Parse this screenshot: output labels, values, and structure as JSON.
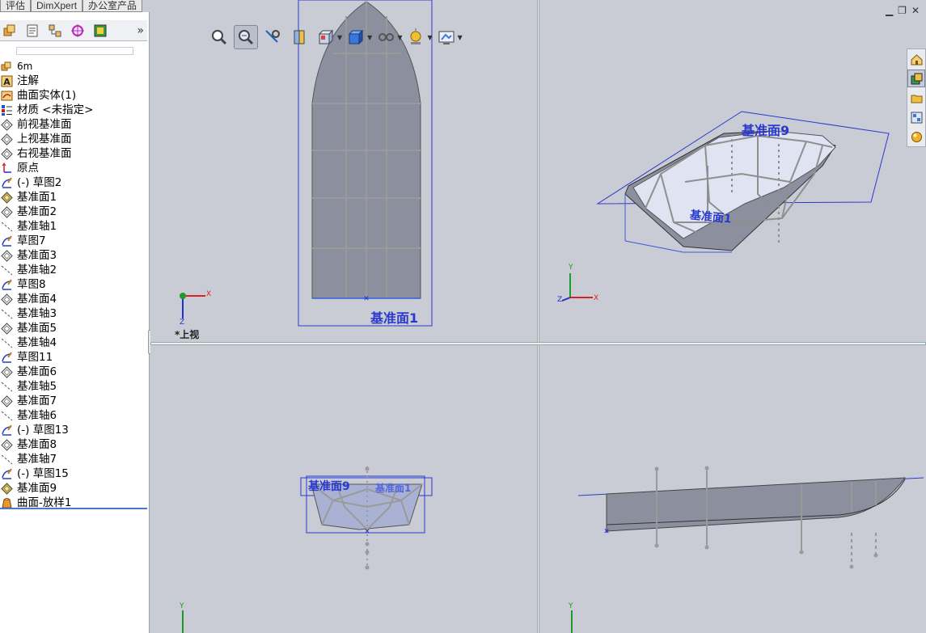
{
  "tabs": [
    "评估",
    "DimXpert",
    "办公室产品"
  ],
  "panel": {
    "more_glyph": "»"
  },
  "tree": {
    "root": "6m",
    "items": [
      {
        "label": "注解",
        "icon": "annotation-icon"
      },
      {
        "label": "曲面实体(1)",
        "icon": "surface-bodies-icon"
      },
      {
        "label": "材质 <未指定>",
        "icon": "material-icon"
      },
      {
        "label": "前视基准面",
        "icon": "plane-icon"
      },
      {
        "label": "上视基准面",
        "icon": "plane-icon"
      },
      {
        "label": "右视基准面",
        "icon": "plane-icon"
      },
      {
        "label": "原点",
        "icon": "origin-icon"
      },
      {
        "label": "(-) 草图2",
        "icon": "sketch-icon"
      },
      {
        "label": "基准面1",
        "icon": "plane-selected-icon"
      },
      {
        "label": "基准面2",
        "icon": "plane-icon"
      },
      {
        "label": "基准轴1",
        "icon": "axis-icon"
      },
      {
        "label": "草图7",
        "icon": "sketch-icon"
      },
      {
        "label": "基准面3",
        "icon": "plane-icon"
      },
      {
        "label": "基准轴2",
        "icon": "axis-icon"
      },
      {
        "label": "草图8",
        "icon": "sketch-icon"
      },
      {
        "label": "基准面4",
        "icon": "plane-icon"
      },
      {
        "label": "基准轴3",
        "icon": "axis-icon"
      },
      {
        "label": "基准面5",
        "icon": "plane-icon"
      },
      {
        "label": "基准轴4",
        "icon": "axis-icon"
      },
      {
        "label": "草图11",
        "icon": "sketch-icon"
      },
      {
        "label": "基准面6",
        "icon": "plane-icon"
      },
      {
        "label": "基准轴5",
        "icon": "axis-icon"
      },
      {
        "label": "基准面7",
        "icon": "plane-icon"
      },
      {
        "label": "基准轴6",
        "icon": "axis-icon"
      },
      {
        "label": "(-) 草图13",
        "icon": "sketch-icon"
      },
      {
        "label": "基准面8",
        "icon": "plane-icon"
      },
      {
        "label": "基准轴7",
        "icon": "axis-icon"
      },
      {
        "label": "(-) 草图15",
        "icon": "sketch-icon"
      },
      {
        "label": "基准面9",
        "icon": "plane-selected-icon"
      },
      {
        "label": "曲面-放样1",
        "icon": "loft-surface-icon"
      }
    ]
  },
  "viewports": {
    "top": {
      "plane_label": "基准面1",
      "view_name": "*上视",
      "axis_x": "X",
      "axis_z": "Z"
    },
    "iso": {
      "plane_label_a": "基准面9",
      "plane_label_b": "基准面1",
      "axis_x": "X",
      "axis_y": "Y",
      "axis_z": "Z"
    },
    "front": {
      "plane_label_a": "基准面9",
      "plane_label_b": "基准面1",
      "axis_y": "Y"
    },
    "right": {
      "axis_y": "Y"
    }
  },
  "hud": [
    "zoom-to-fit-icon",
    "zoom-to-area-icon",
    "previous-view-icon",
    "section-view-icon",
    "view-orientation-icon",
    "display-style-icon",
    "hide-show-items-icon",
    "edit-appearance-icon",
    "apply-scene-icon"
  ],
  "window_controls": {
    "minimize": "▁",
    "restore": "❐",
    "close": "✕"
  },
  "task_pane": [
    "home-icon",
    "design-library-icon",
    "file-explorer-icon",
    "view-palette-icon",
    "appearances-icon"
  ],
  "colors": {
    "viewport_bg": "#c9ccd4",
    "plane_blue": "#2a3ad0",
    "hull_gray": "#8c909e",
    "wire_gray": "#8f8f8f",
    "axis_red": "#e02020",
    "axis_green": "#1c9a2a",
    "axis_blue": "#2030d0"
  }
}
